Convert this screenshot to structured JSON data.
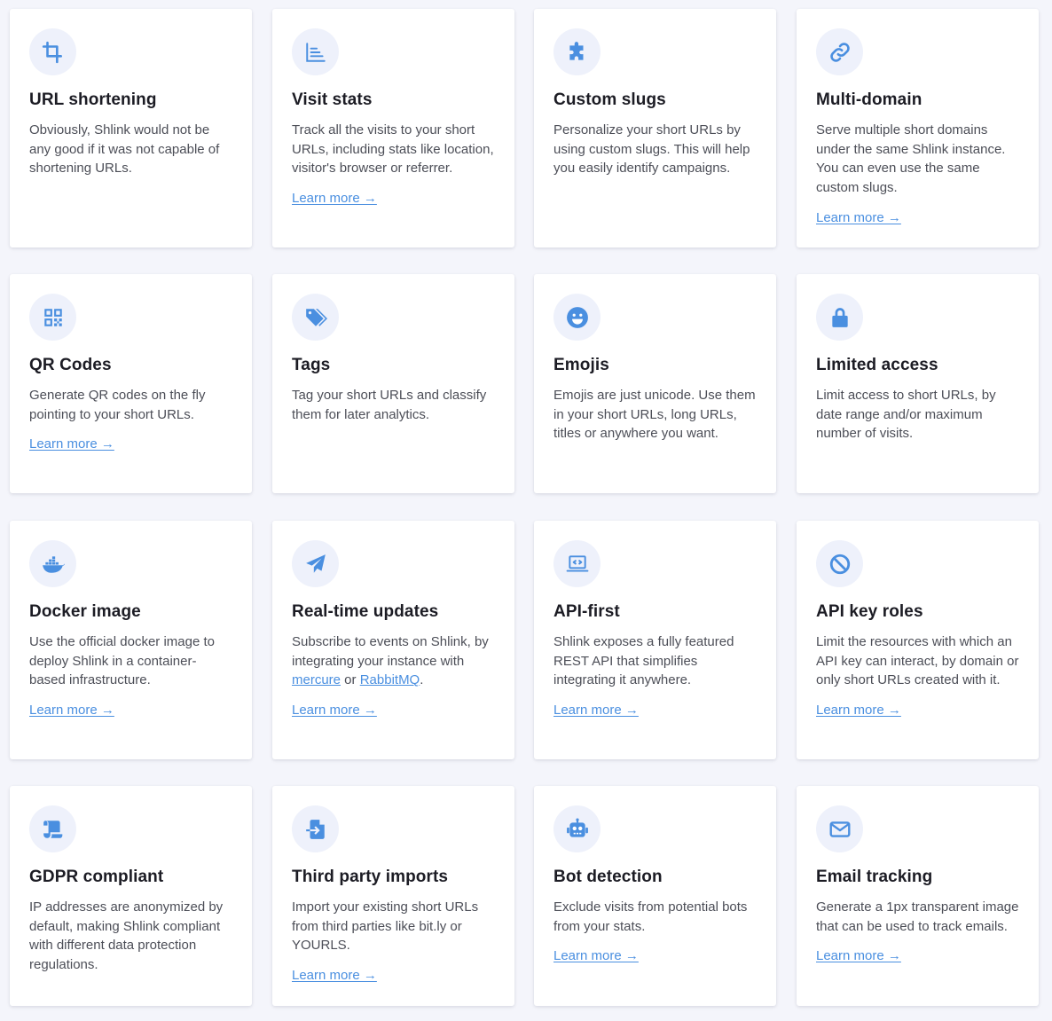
{
  "accent": "#4a8fe0",
  "icon_bg": "#eef1fb",
  "cards": [
    {
      "icon": "crop-icon",
      "title": "URL shortening",
      "desc": "Obviously, Shlink would not be any good if it was not capable of shortening URLs.",
      "learn": ""
    },
    {
      "icon": "chart-icon",
      "title": "Visit stats",
      "desc": "Track all the visits to your short URLs, including stats like location, visitor's browser or referrer.",
      "learn": "Learn more →"
    },
    {
      "icon": "puzzle-icon",
      "title": "Custom slugs",
      "desc": "Personalize your short URLs by using custom slugs. This will help you easily identify campaigns.",
      "learn": ""
    },
    {
      "icon": "link-icon",
      "title": "Multi-domain",
      "desc": "Serve multiple short domains under the same Shlink instance. You can even use the same custom slugs.",
      "learn": "Learn more →"
    },
    {
      "icon": "qrcode-icon",
      "title": "QR Codes",
      "desc": "Generate QR codes on the fly pointing to your short URLs.",
      "learn": "Learn more →"
    },
    {
      "icon": "tags-icon",
      "title": "Tags",
      "desc": "Tag your short URLs and classify them for later analytics.",
      "learn": ""
    },
    {
      "icon": "smile-icon",
      "title": "Emojis",
      "desc": "Emojis are just unicode. Use them in your short URLs, long URLs, titles or anywhere you want.",
      "learn": ""
    },
    {
      "icon": "lock-icon",
      "title": "Limited access",
      "desc": "Limit access to short URLs, by date range and/or maximum number of visits.",
      "learn": ""
    },
    {
      "icon": "docker-icon",
      "title": "Docker image",
      "desc": "Use the official docker image to deploy Shlink in a container-based infrastructure.",
      "learn": "Learn more →"
    },
    {
      "icon": "paper-plane-icon",
      "title": "Real-time updates",
      "desc_pre": "Subscribe to events on Shlink, by integrating your instance with ",
      "link1": "mercure",
      "desc_mid": " or ",
      "link2": "RabbitMQ",
      "desc_post": ".",
      "learn": "Learn more →"
    },
    {
      "icon": "laptop-code-icon",
      "title": "API-first",
      "desc": "Shlink exposes a fully featured REST API that simplifies integrating it anywhere.",
      "learn": "Learn more →"
    },
    {
      "icon": "ban-icon",
      "title": "API key roles",
      "desc": "Limit the resources with which an API key can interact, by domain or only short URLs created with it.",
      "learn": "Learn more →"
    },
    {
      "icon": "scroll-icon",
      "title": "GDPR compliant",
      "desc": "IP addresses are anonymized by default, making Shlink compliant with different data protection regulations.",
      "learn": ""
    },
    {
      "icon": "file-import-icon",
      "title": "Third party imports",
      "desc": "Import your existing short URLs from third parties like bit.ly or YOURLS.",
      "learn": "Learn more →"
    },
    {
      "icon": "robot-icon",
      "title": "Bot detection",
      "desc": "Exclude visits from potential bots from your stats.",
      "learn": "Learn more →"
    },
    {
      "icon": "envelope-icon",
      "title": "Email tracking",
      "desc": "Generate a 1px transparent image that can be used to track emails.",
      "learn": "Learn more →"
    }
  ]
}
